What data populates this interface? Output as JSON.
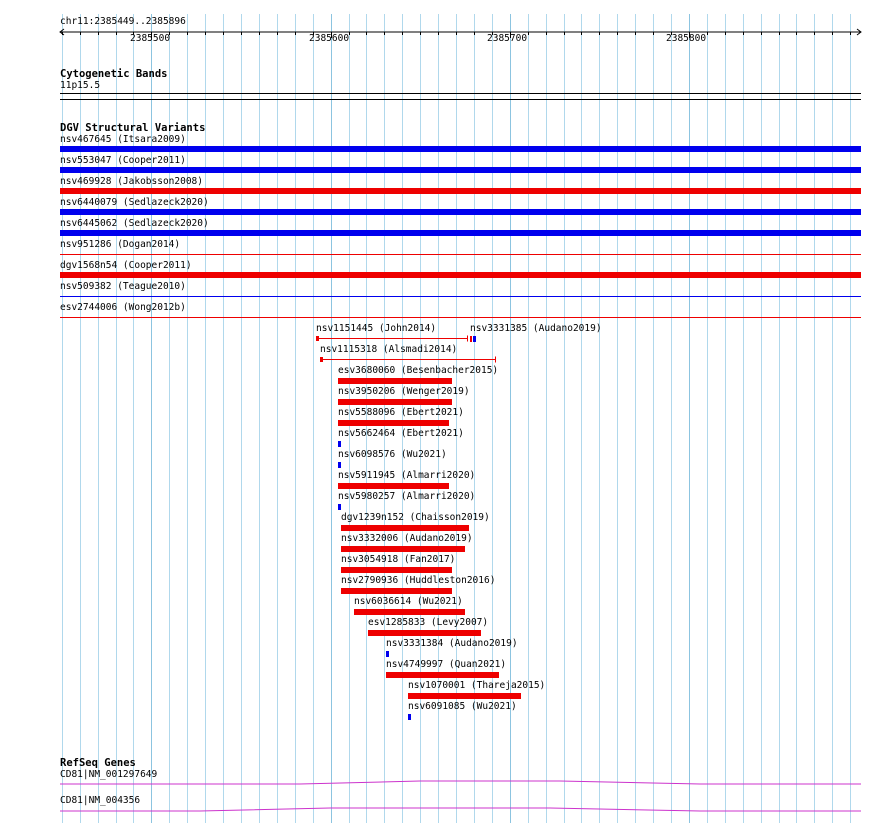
{
  "colors": {
    "gain": "#0000ee",
    "loss": "#ee0000",
    "gene": "#cc33cc",
    "grid": "#b0d8ec"
  },
  "ruler": {
    "location": "chr11:2385449..2385896",
    "ticks": [
      "2385500",
      "2385600",
      "2385700",
      "2385800"
    ]
  },
  "cytoband": {
    "title": "Cytogenetic Bands",
    "label": "11p15.5"
  },
  "dgv": {
    "title": "DGV Structural Variants",
    "full_width": [
      {
        "label": "nsv467645 (Itsara2009)",
        "color": "gain",
        "bar": "thick"
      },
      {
        "label": "nsv553047 (Cooper2011)",
        "color": "gain",
        "bar": "thick"
      },
      {
        "label": "nsv469928 (Jakobsson2008)",
        "color": "loss",
        "bar": "thick"
      },
      {
        "label": "nsv6440079 (Sedlazeck2020)",
        "color": "gain",
        "bar": "thick"
      },
      {
        "label": "nsv6445062 (Sedlazeck2020)",
        "color": "gain",
        "bar": "thick"
      },
      {
        "label": "nsv951286 (Dogan2014)",
        "color": "loss",
        "bar": "thin"
      },
      {
        "label": "dgv1568n54 (Cooper2011)",
        "color": "loss",
        "bar": "thick"
      },
      {
        "label": "nsv509382 (Teague2010)",
        "color": "gain",
        "bar": "thin"
      },
      {
        "label": "esv2744006 (Wong2012b)",
        "color": "loss",
        "bar": "thin"
      }
    ],
    "local": [
      {
        "label": "nsv1151445 (John2014)",
        "color": "loss",
        "style": "span",
        "start": 2385592,
        "end": 2385676
      },
      {
        "label": "nsv3331385 (Audano2019)",
        "color": "mixed",
        "style": "tick",
        "start": 2385678,
        "end": 2385682
      },
      {
        "label": "nsv1115318 (Alsmadi2014)",
        "color": "loss",
        "style": "span",
        "start": 2385594,
        "end": 2385692
      },
      {
        "label": "esv3680060 (Besenbacher2015)",
        "color": "loss",
        "style": "bar",
        "start": 2385604,
        "end": 2385668
      },
      {
        "label": "nsv3950206 (Wenger2019)",
        "color": "loss",
        "style": "bar",
        "start": 2385604,
        "end": 2385668
      },
      {
        "label": "nsv5588096 (Ebert2021)",
        "color": "loss",
        "style": "bar",
        "start": 2385604,
        "end": 2385666
      },
      {
        "label": "nsv5662464 (Ebert2021)",
        "color": "gain",
        "style": "tick",
        "start": 2385604,
        "end": 2385605
      },
      {
        "label": "nsv6098576 (Wu2021)",
        "color": "gain",
        "style": "tick",
        "start": 2385604,
        "end": 2385605
      },
      {
        "label": "nsv5911945 (Almarri2020)",
        "color": "loss",
        "style": "bar",
        "start": 2385604,
        "end": 2385666
      },
      {
        "label": "nsv5980257 (Almarri2020)",
        "color": "gain",
        "style": "tick",
        "start": 2385604,
        "end": 2385605
      },
      {
        "label": "dgv1239n152 (Chaisson2019)",
        "color": "loss",
        "style": "bar",
        "start": 2385606,
        "end": 2385677
      },
      {
        "label": "nsv3332006 (Audano2019)",
        "color": "loss",
        "style": "bar",
        "start": 2385606,
        "end": 2385675
      },
      {
        "label": "nsv3054918 (Fan2017)",
        "color": "loss",
        "style": "bar",
        "start": 2385606,
        "end": 2385668
      },
      {
        "label": "nsv2790936 (Huddleston2016)",
        "color": "loss",
        "style": "bar",
        "start": 2385606,
        "end": 2385668
      },
      {
        "label": "nsv6036614 (Wu2021)",
        "color": "loss",
        "style": "bar",
        "start": 2385613,
        "end": 2385675
      },
      {
        "label": "esv1285833 (Levy2007)",
        "color": "loss",
        "style": "bar",
        "start": 2385621,
        "end": 2385684
      },
      {
        "label": "nsv3331384 (Audano2019)",
        "color": "gain",
        "style": "tick",
        "start": 2385631,
        "end": 2385632
      },
      {
        "label": "nsv4749997 (Quan2021)",
        "color": "loss",
        "style": "bar",
        "start": 2385631,
        "end": 2385694
      },
      {
        "label": "nsv1070001 (Thareja2015)",
        "color": "loss",
        "style": "bar",
        "start": 2385643,
        "end": 2385706
      },
      {
        "label": "nsv6091085 (Wu2021)",
        "color": "gain",
        "style": "tick",
        "start": 2385643,
        "end": 2385644
      }
    ]
  },
  "refseq": {
    "title": "RefSeq Genes",
    "transcripts": [
      "CD81|NM_001297649",
      "CD81|NM_004356"
    ]
  }
}
